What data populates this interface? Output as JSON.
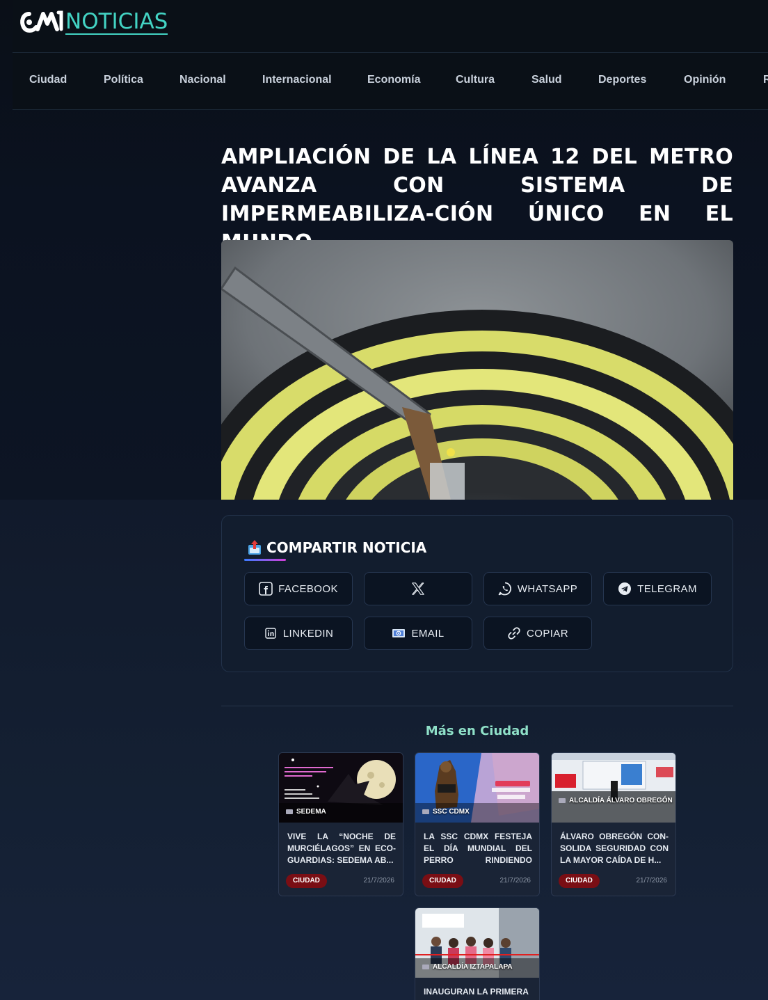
{
  "brand": {
    "name": "NOTICIAS",
    "accent": "#43d3c3",
    "logo_icon": "cdmx-logo-icon"
  },
  "nav": [
    "Ciudad",
    "Política",
    "Nacional",
    "Internacional",
    "Economía",
    "Cultura",
    "Salud",
    "Deportes",
    "Opinión",
    "R"
  ],
  "article": {
    "title": "AMPLIACIÓN DE LA LÍNEA 12 DEL METRO AVANZA CON SISTEMA DE IMPERMEABILIZA-CIÓN ÚNICO EN EL MUNDO"
  },
  "share": {
    "title": "COMPARTIR NOTICIA",
    "icon": "share-icon",
    "buttons": [
      {
        "id": "facebook",
        "label": "FACEBOOK",
        "icon": "facebook-icon"
      },
      {
        "id": "x",
        "label": "",
        "icon": "x-icon"
      },
      {
        "id": "whatsapp",
        "label": "WHATSAPP",
        "icon": "whatsapp-icon"
      },
      {
        "id": "telegram",
        "label": "TELEGRAM",
        "icon": "telegram-icon"
      },
      {
        "id": "linkedin",
        "label": "LINKEDIN",
        "icon": "linkedin-icon"
      },
      {
        "id": "email",
        "label": "EMAIL",
        "icon": "email-icon"
      },
      {
        "id": "copy",
        "label": "COPIAR",
        "icon": "link-icon"
      }
    ]
  },
  "more": {
    "title": "Más en Ciudad",
    "cards": [
      {
        "source": "SEDEMA",
        "title": "VIVE LA “NOCHE DE MURCIÉLAGOS” EN ECO-GUARDIAS: SEDEMA AB...",
        "badge": "CIUDAD",
        "date": "21/7/2026"
      },
      {
        "source": "SSC CDMX",
        "title": "LA SSC CDMX FESTEJA EL DÍA MUNDIAL DEL PERRO RINDIENDO HOMENAJE...",
        "badge": "CIUDAD",
        "date": "21/7/2026"
      },
      {
        "source": "ALCALDÍA ÁLVARO OBREGÓN",
        "title": "ÁLVARO OBREGÓN CON-SOLIDA SEGURIDAD CON LA MAYOR CAÍDA DE H...",
        "badge": "CIUDAD",
        "date": "21/7/2026"
      },
      {
        "source": "ALCALDÍA IZTAPALAPA",
        "title": "INAUGURAN LA PRIMERA",
        "badge": "",
        "date": ""
      }
    ]
  }
}
